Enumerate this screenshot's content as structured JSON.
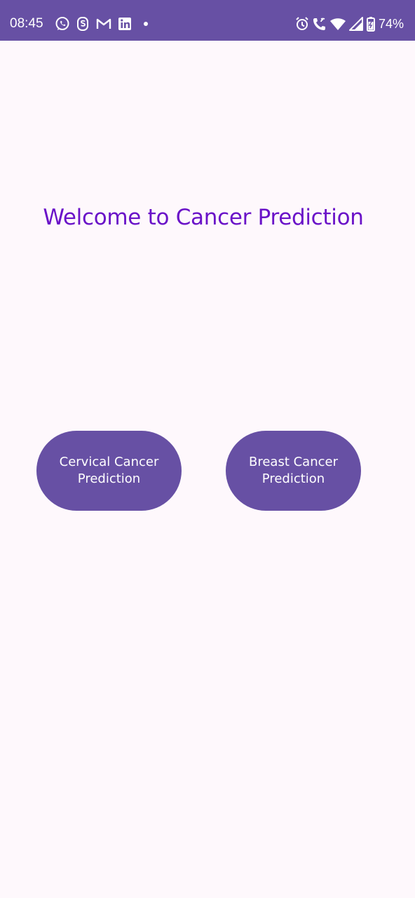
{
  "status_bar": {
    "time": "08:45",
    "battery": "74%",
    "icons": [
      "whatsapp-icon",
      "s-app-icon",
      "gmail-icon",
      "linkedin-icon",
      "dot-icon",
      "alarm-icon",
      "wifi-call-icon",
      "wifi-icon",
      "signal-icon",
      "battery-icon"
    ],
    "color": "#6750a4"
  },
  "main": {
    "title": "Welcome to Cancer Prediction",
    "title_color": "#6a12c8",
    "buttons": {
      "cervical": "Cervical Cancer Prediction",
      "breast": "Breast Cancer Prediction"
    },
    "button_color": "#6750a4"
  }
}
